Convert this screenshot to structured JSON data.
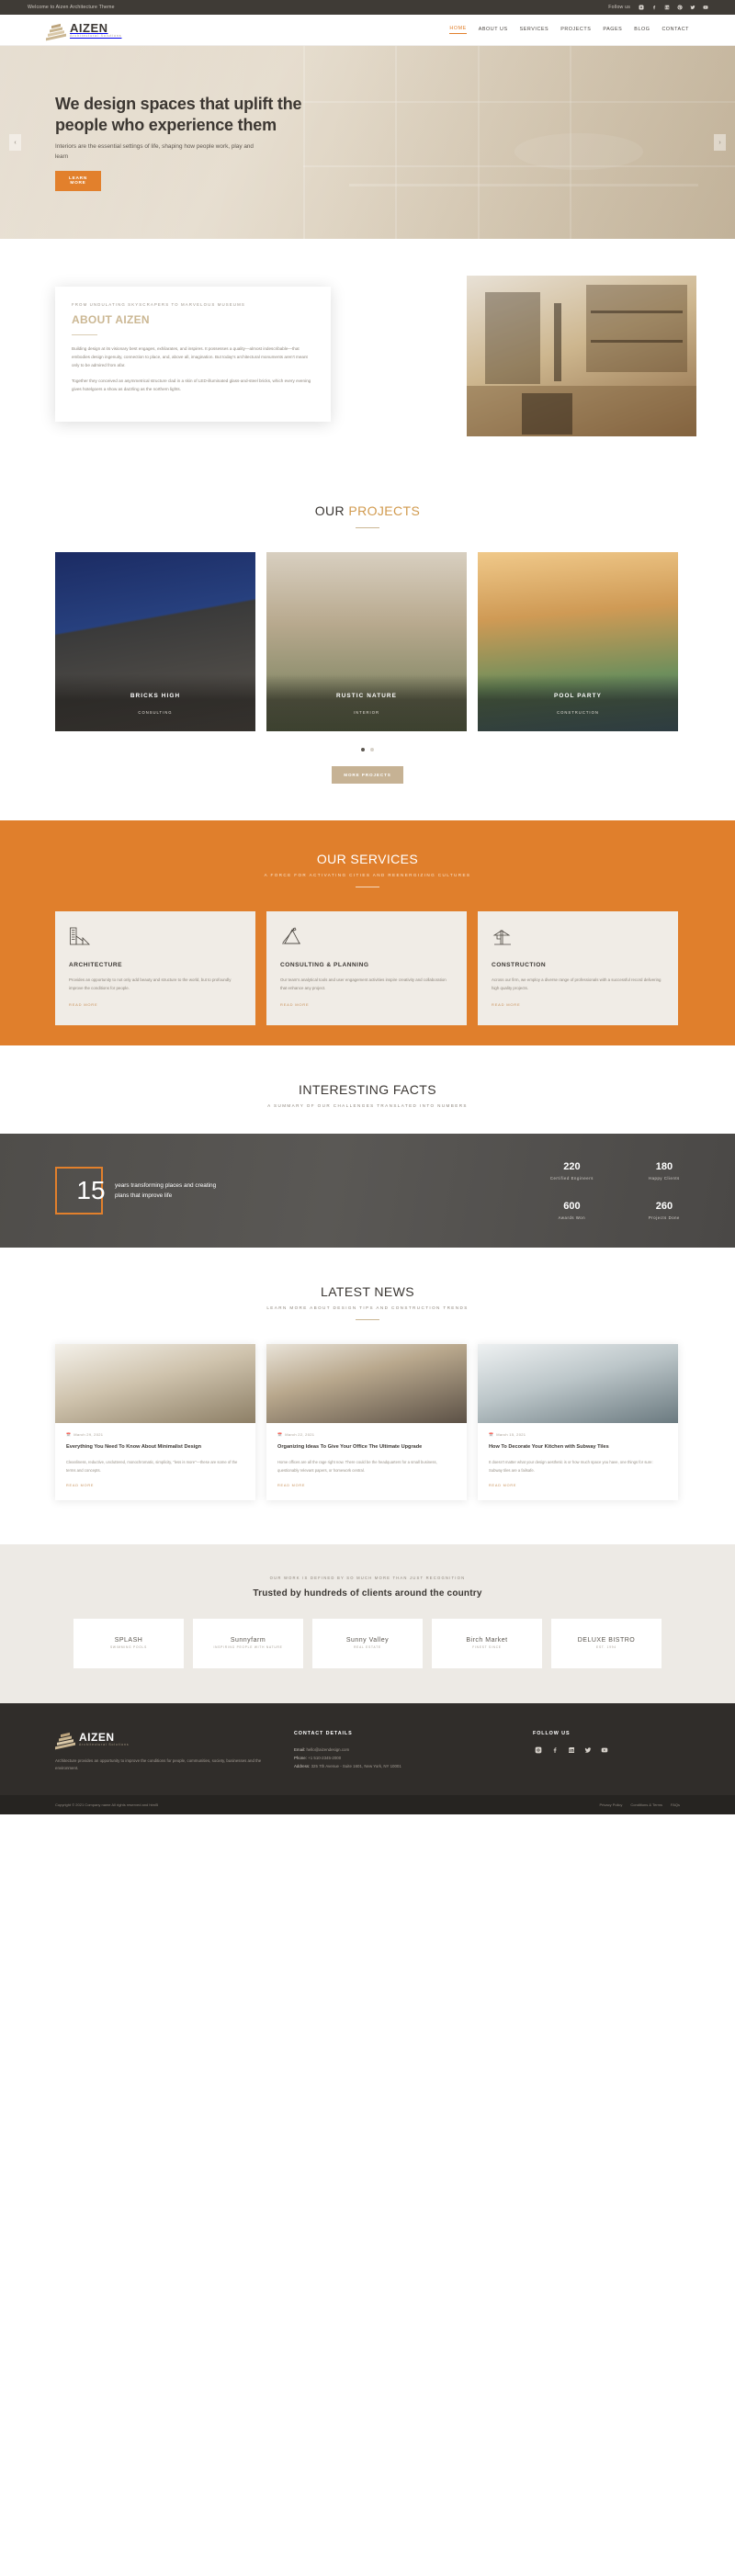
{
  "topbar": {
    "welcome": "Welcome to Aizen Architecture Theme",
    "follow_label": "Follow us",
    "social": [
      "instagram-icon",
      "facebook-icon",
      "linkedin-icon",
      "pinterest-icon",
      "twitter-icon",
      "youtube-icon"
    ]
  },
  "brand": {
    "name": "AIZEN",
    "tagline": "Architectural Solutions"
  },
  "nav": [
    {
      "label": "HOME",
      "active": true
    },
    {
      "label": "ABOUT US",
      "active": false
    },
    {
      "label": "SERVICES",
      "active": false
    },
    {
      "label": "PROJECTS",
      "active": false
    },
    {
      "label": "PAGES",
      "active": false
    },
    {
      "label": "BLOG",
      "active": false
    },
    {
      "label": "CONTACT",
      "active": false
    }
  ],
  "hero": {
    "title": "We design spaces that uplift the people who experience them",
    "subtitle": "Interiors are the essential settings of life, shaping how people work, play and learn",
    "cta": "LEARN MORE",
    "prev_icon": "chevron-left-icon",
    "next_icon": "chevron-right-icon"
  },
  "about": {
    "kicker": "FROM UNDULATING SKYSCRAPERS TO MARVELOUS MUSEUMS",
    "title_main": "ABOUT",
    "title_accent": "AIZEN",
    "paragraph1": "Building design at its visionary best engages, exhilarates, and inspires. It possesses a quality—almost indescribable—that embodies design ingenuity, connection to place, and, above all, imagination. But today's architectural monuments aren't meant only to be admired from afar.",
    "paragraph2": "Together they conceived an asymmetrical structure clad in a skin of LED-illuminated glass-and-steel bricks, which every evening gives hotelgoers a show as dazzling as the northern lights."
  },
  "projects": {
    "title_main": "OUR",
    "title_accent": "PROJECTS",
    "items": [
      {
        "name": "BRICKS HIGH",
        "category": "CONSULTING"
      },
      {
        "name": "RUSTIC NATURE",
        "category": "INTERIOR"
      },
      {
        "name": "POOL PARTY",
        "category": "CONSTRUCTION"
      }
    ],
    "dots": [
      true,
      false
    ],
    "cta": "MORE PROJECTS"
  },
  "services": {
    "title": "OUR SERVICES",
    "subtitle": "A FORCE FOR ACTIVATING CITIES AND REENERGIZING CULTURES",
    "items": [
      {
        "icon": "building-icon",
        "title": "ARCHITECTURE",
        "text": "Provides an opportunity to not only add beauty and structure to the world, but to profoundly improve the conditions for people.",
        "more": "READ MORE"
      },
      {
        "icon": "drafting-tools-icon",
        "title": "CONSULTING & PLANNING",
        "text": "Our team's analytical tools and user engagement activities inspire creativity and collaboration that enhance any project.",
        "more": "READ MORE"
      },
      {
        "icon": "crane-icon",
        "title": "CONSTRUCTION",
        "text": "Across our firm, we employ a diverse range of professionals with a successful record delivering high quality projects.",
        "more": "READ MORE"
      }
    ]
  },
  "facts": {
    "title": "INTERESTING FACTS",
    "subtitle": "A SUMMARY OF OUR CHALLENGES TRANSLATED INTO NUMBERS",
    "years_number": "15",
    "years_text": "years transforming places and creating plans that improve life",
    "stats": [
      {
        "number": "220",
        "label": "Certified Engineers"
      },
      {
        "number": "600",
        "label": "Awards Won"
      },
      {
        "number": "180",
        "label": "Happy Clients"
      },
      {
        "number": "260",
        "label": "Projects Done"
      }
    ]
  },
  "news": {
    "title": "LATEST NEWS",
    "subtitle": "LEARN MORE ABOUT DESIGN TIPS AND CONSTRUCTION TRENDS",
    "items": [
      {
        "date": "March 29, 2021",
        "title": "Everything You Need To Know About Minimalist Design",
        "excerpt": "Cleanliness, reductive, uncluttered, monochromatic, simplicity, \"less is more\"—these are some of the terms and concepts.",
        "more": "READ MORE"
      },
      {
        "date": "March 22, 2021",
        "title": "Organizing Ideas To Give Your Office The Ultimate Upgrade",
        "excerpt": "Home offices are all the rage right now. There could be the headquarters for a small business, questionably relevant papers, or homework central.",
        "more": "READ MORE"
      },
      {
        "date": "March 15, 2021",
        "title": "How To Decorate Your Kitchen with Subway Tiles",
        "excerpt": "It doesn't matter what your design aesthetic is or how much space you have, one things for sure: Subway tiles are a failsafe.",
        "more": "READ MORE"
      }
    ]
  },
  "clients": {
    "kicker": "OUR WORK IS DEFINED BY SO MUCH MORE THAN JUST RECOGNITION",
    "title": "Trusted by hundreds of clients around the country",
    "logos": [
      {
        "main": "SPLASH",
        "sub": "Swimming Pools"
      },
      {
        "main": "Sunnyfarm",
        "sub": "Inspiring People With Nature"
      },
      {
        "main": "Sunny Valley",
        "sub": "Real Estate"
      },
      {
        "main": "Birch Market",
        "sub": "Finest Since"
      },
      {
        "main": "DELUXE BISTRO",
        "sub": "Est. 1994"
      }
    ]
  },
  "footer": {
    "blurb": "Architecture provides an opportunity to improve the conditions for people, communities, society, businesses and the environment.",
    "contact_title": "CONTACT DETAILS",
    "email_label": "Email:",
    "email": "hello@aizendesign.com",
    "phone_label": "Phone:",
    "phone": "+1 510-2345-2000",
    "address_label": "Address:",
    "address": "325 7th Avenue - Suite 1601, New York, NY 10001",
    "follow_title": "FOLLOW US",
    "social": [
      "instagram-icon",
      "facebook-icon",
      "linkedin-icon",
      "twitter-icon",
      "youtube-icon"
    ],
    "copyright": "Copyright © 2021 Company name All rights reserved and html5",
    "links": [
      "Privacy Policy",
      "Conditions & Terms",
      "FAQs"
    ]
  },
  "colors": {
    "accent_orange": "#e2802c",
    "accent_tan": "#cbb793",
    "dark": "#302d2a"
  }
}
